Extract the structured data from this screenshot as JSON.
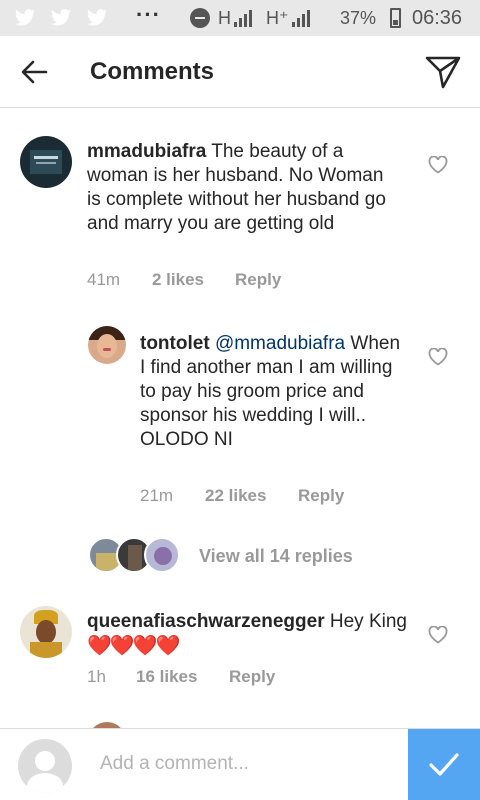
{
  "status_bar": {
    "network_1": "H",
    "network_2": "H⁺",
    "battery": "37%",
    "time": "06:36"
  },
  "header": {
    "title": "Comments"
  },
  "comments": [
    {
      "username": "mmadubiafra",
      "text": "The beauty of a woman is her husband. No Woman is complete without her husband go and marry you are getting old",
      "time": "41m",
      "likes": "2 likes",
      "reply": "Reply"
    },
    {
      "username": "tontolet",
      "mention": "@mmadubiafra",
      "text": "When I find another man I am willing to pay his groom price and sponsor his wedding I will..",
      "text2": "OLODO NI",
      "time": "21m",
      "likes": "22 likes",
      "reply": "Reply"
    },
    {
      "username": "queenafiaschwarzenegger",
      "text": "Hey King",
      "emoji": "❤️❤️❤️❤️",
      "time": "1h",
      "likes": "16 likes",
      "reply": "Reply"
    }
  ],
  "view_replies": "View all 14 replies",
  "composer": {
    "placeholder": "Add a comment..."
  },
  "colors": {
    "accent": "#3897f0",
    "heart": "#ed1c24",
    "meta": "#999999",
    "mention": "#003569"
  }
}
